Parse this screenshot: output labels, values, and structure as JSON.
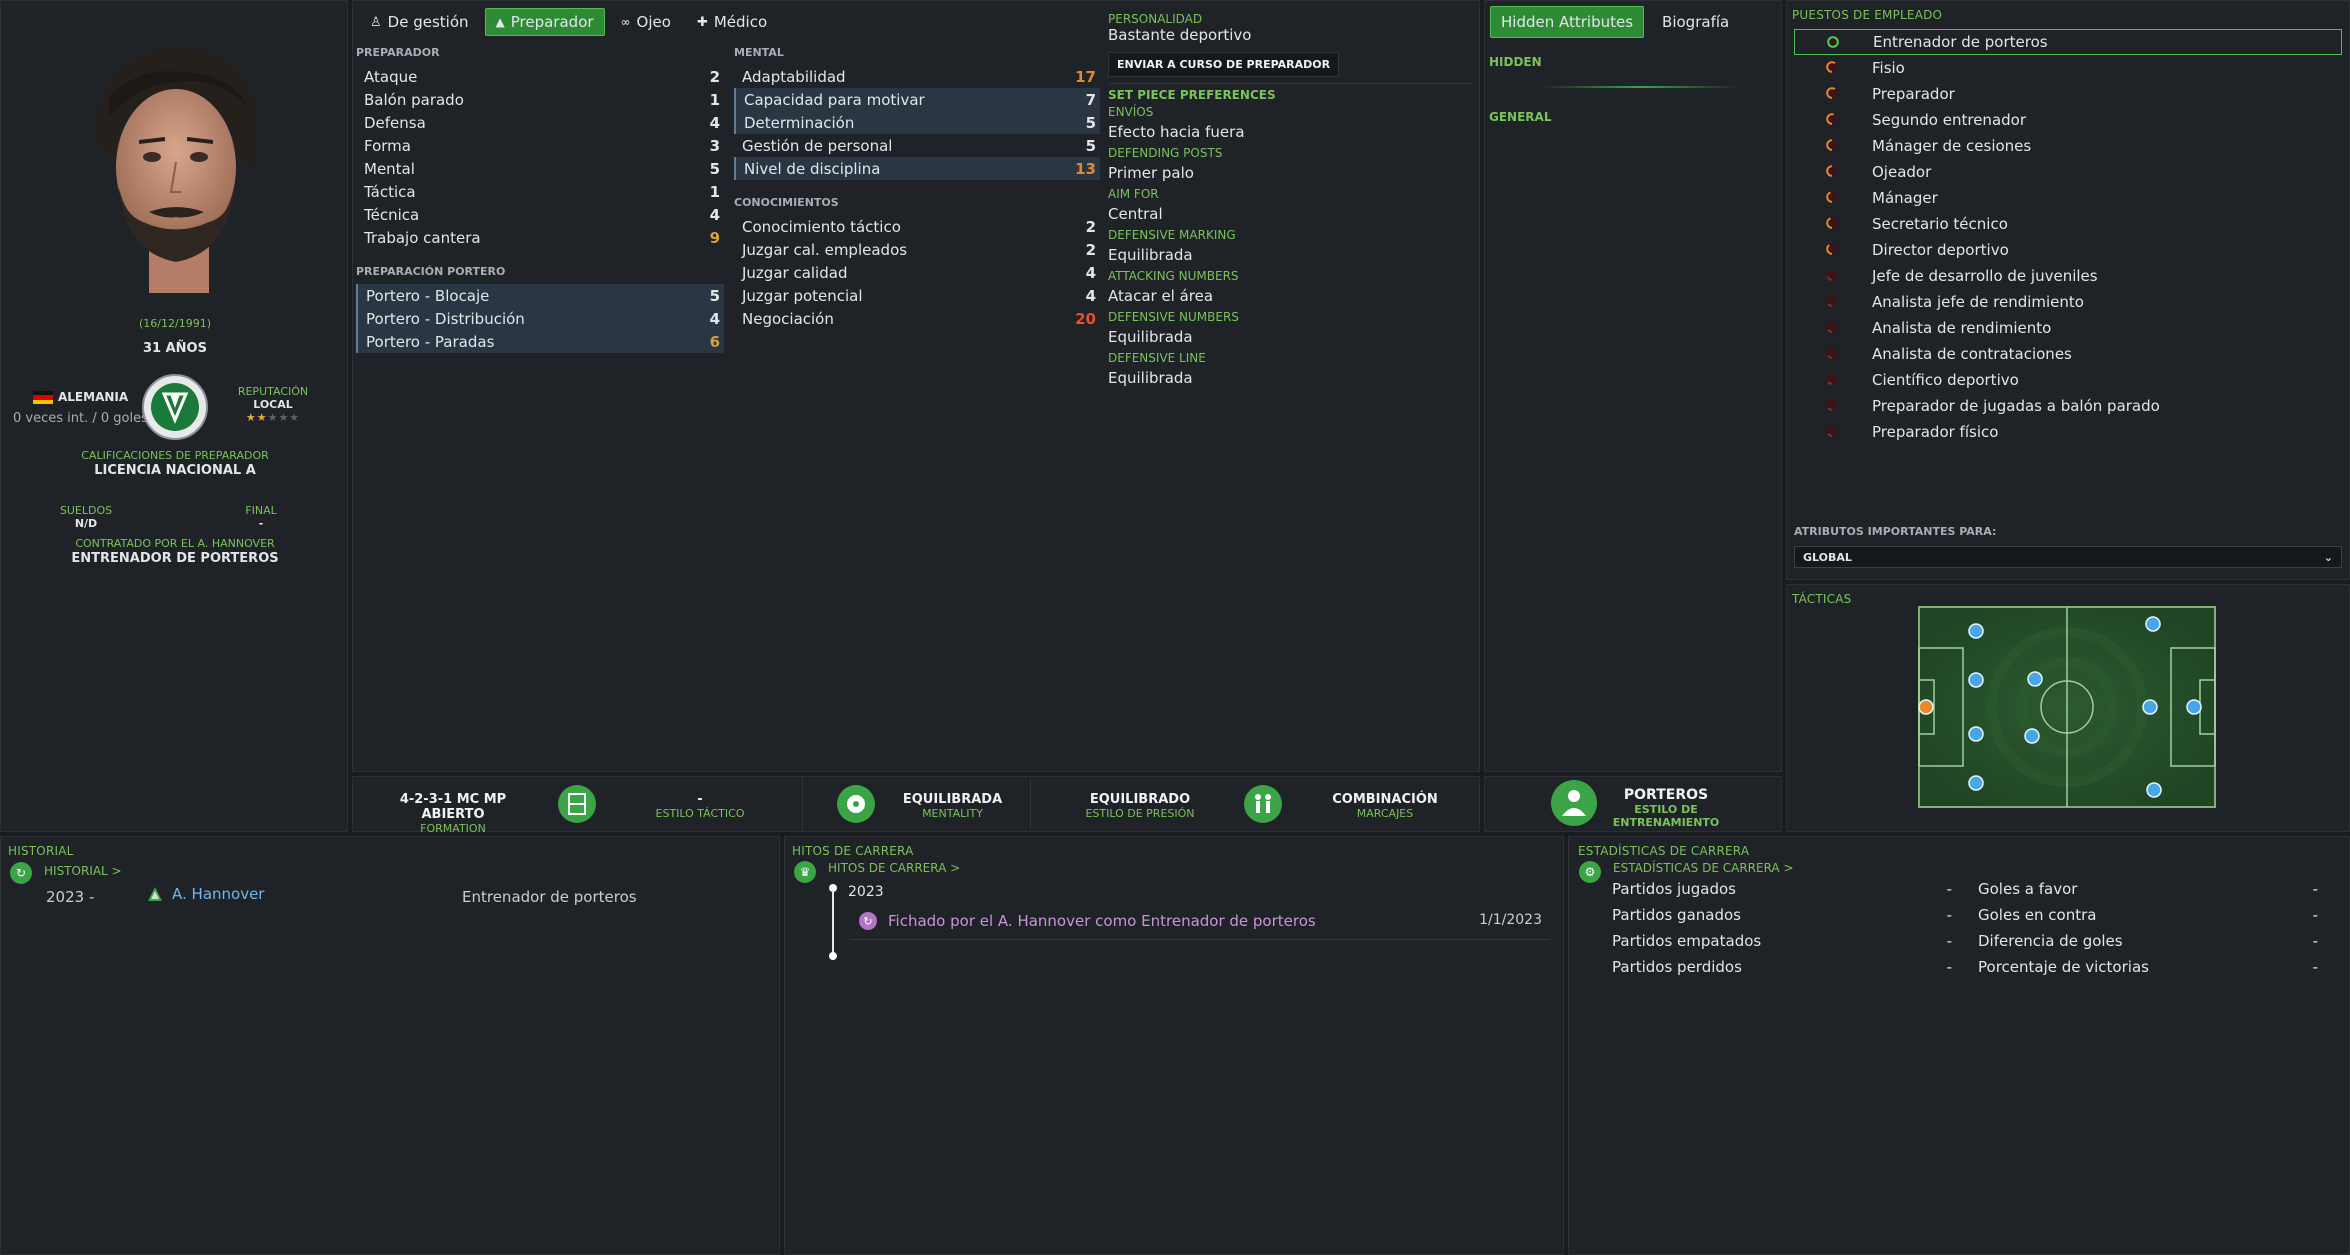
{
  "profile": {
    "dob": "(16/12/1991)",
    "age": "31 AÑOS",
    "nation": "ALEMANIA",
    "caps": "0 veces int. / 0 goles",
    "reputation_label": "REPUTACIÓN",
    "reputation_value": "LOCAL",
    "coaching_label": "CALIFICACIONES DE PREPARADOR",
    "coaching_value": "LICENCIA NACIONAL A",
    "wages_label": "SUELDOS",
    "wages_value": "N/D",
    "end_label": "FINAL",
    "end_value": "-",
    "contract_label": "CONTRATADO POR EL A. HANNOVER",
    "contract_value": "ENTRENADOR DE PORTEROS"
  },
  "tabs": [
    {
      "label": "De gestión",
      "icon": "person-icon"
    },
    {
      "label": "Preparador",
      "icon": "cone-icon",
      "active": true
    },
    {
      "label": "Ojeo",
      "icon": "binoculars-icon"
    },
    {
      "label": "Médico",
      "icon": "medkit-icon"
    }
  ],
  "coach": {
    "heading": "PREPARADOR",
    "items": [
      {
        "name": "Ataque",
        "value": "2",
        "color": "white",
        "hl": false
      },
      {
        "name": "Balón parado",
        "value": "1",
        "color": "white",
        "hl": false
      },
      {
        "name": "Defensa",
        "value": "4",
        "color": "white",
        "hl": false
      },
      {
        "name": "Forma",
        "value": "3",
        "color": "white",
        "hl": false
      },
      {
        "name": "Mental",
        "value": "5",
        "color": "white",
        "hl": false
      },
      {
        "name": "Táctica",
        "value": "1",
        "color": "white",
        "hl": false
      },
      {
        "name": "Técnica",
        "value": "4",
        "color": "white",
        "hl": false
      },
      {
        "name": "Trabajo cantera",
        "value": "9",
        "color": "amber",
        "hl": false
      }
    ]
  },
  "gk": {
    "heading": "PREPARACIÓN PORTERO",
    "items": [
      {
        "name": "Portero - Blocaje",
        "value": "5",
        "color": "white",
        "hl": true
      },
      {
        "name": "Portero - Distribución",
        "value": "4",
        "color": "white",
        "hl": true
      },
      {
        "name": "Portero - Paradas",
        "value": "6",
        "color": "amber",
        "hl": true
      }
    ]
  },
  "mental": {
    "heading": "MENTAL",
    "items": [
      {
        "name": "Adaptabilidad",
        "value": "17",
        "color": "orange",
        "hl": false
      },
      {
        "name": "Capacidad para motivar",
        "value": "7",
        "color": "white",
        "hl": true
      },
      {
        "name": "Determinación",
        "value": "5",
        "color": "white",
        "hl": true
      },
      {
        "name": "Gestión de personal",
        "value": "5",
        "color": "white",
        "hl": false
      },
      {
        "name": "Nivel de disciplina",
        "value": "13",
        "color": "orange",
        "hl": true
      }
    ]
  },
  "knowledge": {
    "heading": "CONOCIMIENTOS",
    "items": [
      {
        "name": "Conocimiento táctico",
        "value": "2",
        "color": "white",
        "hl": false
      },
      {
        "name": "Juzgar cal. empleados",
        "value": "2",
        "color": "white",
        "hl": false
      },
      {
        "name": "Juzgar calidad",
        "value": "4",
        "color": "white",
        "hl": false
      },
      {
        "name": "Juzgar potencial",
        "value": "4",
        "color": "white",
        "hl": false
      },
      {
        "name": "Negociación",
        "value": "20",
        "color": "red",
        "hl": false
      }
    ]
  },
  "personality": {
    "label": "PERSONALIDAD",
    "value": "Bastante deportivo",
    "button": "ENVIAR A CURSO DE PREPARADOR",
    "spp_heading": "SET PIECE PREFERENCES",
    "prefs": [
      {
        "label": "ENVÍOS",
        "value": "Efecto hacia fuera"
      },
      {
        "label": "DEFENDING POSTS",
        "value": "Primer palo"
      },
      {
        "label": "AIM FOR",
        "value": "Central"
      },
      {
        "label": "DEFENSIVE MARKING",
        "value": "Equilibrada"
      },
      {
        "label": "ATTACKING NUMBERS",
        "value": "Atacar el área"
      },
      {
        "label": "DEFENSIVE NUMBERS",
        "value": "Equilibrada"
      },
      {
        "label": "DEFENSIVE LINE",
        "value": "Equilibrada"
      }
    ]
  },
  "hidden": {
    "tab_hidden": "Hidden Attributes",
    "tab_bio": "Biografía",
    "hidden_heading": "HIDDEN",
    "general_heading": "GENERAL"
  },
  "style_bar": {
    "formation_value": "4-2-3-1 MC MP ABIERTO",
    "formation_label": "FORMATION",
    "tactical_value": "-",
    "tactical_label": "ESTILO TÁCTICO",
    "mentality_value": "EQUILIBRADA",
    "mentality_label": "MENTALITY",
    "press_value": "EQUILIBRADO",
    "press_label": "ESTILO DE PRESIÓN",
    "marking_value": "COMBINACIÓN",
    "marking_label": "MARCAJES",
    "training_value": "PORTEROS",
    "training_label": "ESTILO DE ENTRENAMIENTO"
  },
  "roles": {
    "heading": "PUESTOS DE EMPLEADO",
    "items": [
      {
        "name": "Entrenador de porteros",
        "fill": 1.0,
        "sel": true
      },
      {
        "name": "Fisio",
        "fill": 0.6,
        "sel": false
      },
      {
        "name": "Preparador",
        "fill": 0.6,
        "sel": false
      },
      {
        "name": "Segundo entrenador",
        "fill": 0.55,
        "sel": false
      },
      {
        "name": "Mánager de cesiones",
        "fill": 0.5,
        "sel": false
      },
      {
        "name": "Ojeador",
        "fill": 0.5,
        "sel": false
      },
      {
        "name": "Mánager",
        "fill": 0.45,
        "sel": false
      },
      {
        "name": "Secretario técnico",
        "fill": 0.45,
        "sel": false
      },
      {
        "name": "Director deportivo",
        "fill": 0.4,
        "sel": false
      },
      {
        "name": "Jefe de desarrollo de juveniles",
        "fill": 0.2,
        "sel": false
      },
      {
        "name": "Analista jefe de rendimiento",
        "fill": 0.15,
        "sel": false
      },
      {
        "name": "Analista de rendimiento",
        "fill": 0.15,
        "sel": false
      },
      {
        "name": "Analista de contrataciones",
        "fill": 0.15,
        "sel": false
      },
      {
        "name": "Científico deportivo",
        "fill": 0.15,
        "sel": false
      },
      {
        "name": "Preparador de jugadas a balón parado",
        "fill": 0.15,
        "sel": false
      },
      {
        "name": "Preparador físico",
        "fill": 0.15,
        "sel": false
      }
    ],
    "important_label": "ATRIBUTOS IMPORTANTES PARA:",
    "important_value": "GLOBAL"
  },
  "tactics": {
    "heading": "TÁCTICAS"
  },
  "history": {
    "heading": "HISTORIAL",
    "link": "HISTORIAL >",
    "year": "2023 -",
    "club": "A. Hannover",
    "role": "Entrenador de porteros"
  },
  "milestones": {
    "heading": "HITOS DE CARRERA",
    "link": "HITOS DE CARRERA >",
    "year": "2023",
    "event": "Fichado por el A. Hannover como Entrenador de porteros",
    "date": "1/1/2023"
  },
  "career_stats": {
    "heading": "ESTADÍSTICAS DE CARRERA",
    "link": "ESTADÍSTICAS DE CARRERA >",
    "left": [
      {
        "name": "Partidos jugados",
        "value": "-"
      },
      {
        "name": "Partidos ganados",
        "value": "-"
      },
      {
        "name": "Partidos empatados",
        "value": "-"
      },
      {
        "name": "Partidos perdidos",
        "value": "-"
      }
    ],
    "right": [
      {
        "name": "Goles a favor",
        "value": "-"
      },
      {
        "name": "Goles en contra",
        "value": "-"
      },
      {
        "name": "Diferencia de goles",
        "value": "-"
      },
      {
        "name": "Porcentaje de victorias",
        "value": "-"
      }
    ]
  },
  "colors": {
    "accent": "#79c35a",
    "orange": "#e2892f",
    "red": "#e8502a",
    "amber": "#d6a23c",
    "player_blue": "#46a6e6",
    "player_gk": "#e98a2b"
  }
}
